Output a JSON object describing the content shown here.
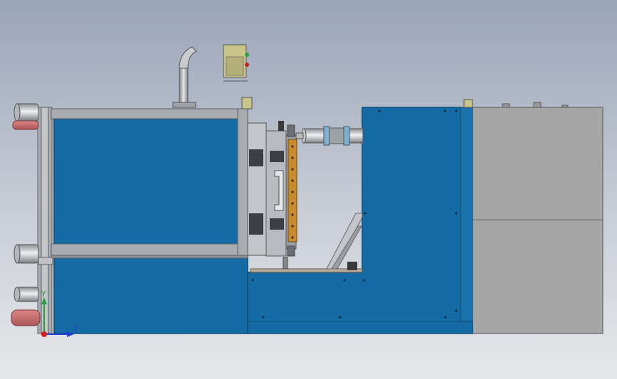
{
  "viewport": {
    "background": "gradient-grey-blue",
    "colors": {
      "blue_panel": "#156ba3",
      "blue_edge": "#0e4c78",
      "frame_grey": "#a9acb1",
      "frame_edge": "#5c5f63",
      "cabinet_grey": "#a6a6a6",
      "olive_box": "#c9c48a",
      "orange_strip": "#c98a2a",
      "pad_red": "#c06a6a"
    }
  },
  "triad": {
    "x_label": "",
    "y_label": "Y",
    "z_label": "Z",
    "x_color": "#d02020",
    "y_color": "#20a040",
    "z_color": "#2040d0"
  }
}
